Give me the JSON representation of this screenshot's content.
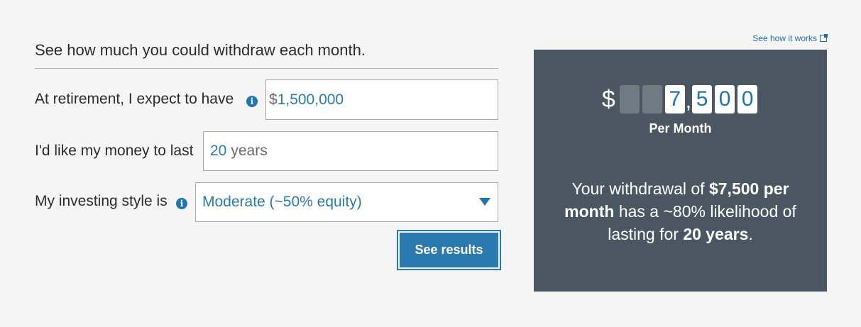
{
  "header": {
    "title": "See how much you could withdraw each month.",
    "how_it_works_link": "See how it works"
  },
  "form": {
    "savings": {
      "label": "At retirement, I expect to have",
      "prefix": "$",
      "value": "1,500,000"
    },
    "duration": {
      "label": "I'd like my money to last",
      "value": "20",
      "suffix": "years"
    },
    "investing_style": {
      "label": "My investing style is",
      "selected": "Moderate (~50% equity)"
    },
    "submit_label": "See results"
  },
  "result": {
    "currency": "$",
    "digits": [
      "",
      "",
      "7",
      "5",
      "0",
      "0"
    ],
    "comma": ",",
    "period_label": "Per Month",
    "sentence": {
      "part1": "Your withdrawal of ",
      "amount_bold": "$7,500 per month",
      "part2": " has a ~80% likelihood of lasting for ",
      "years_bold": "20 years",
      "part3": "."
    }
  },
  "colors": {
    "accent": "#2a7ab0",
    "panel_bg": "#4a5661",
    "page_bg": "#f5f5f5"
  }
}
